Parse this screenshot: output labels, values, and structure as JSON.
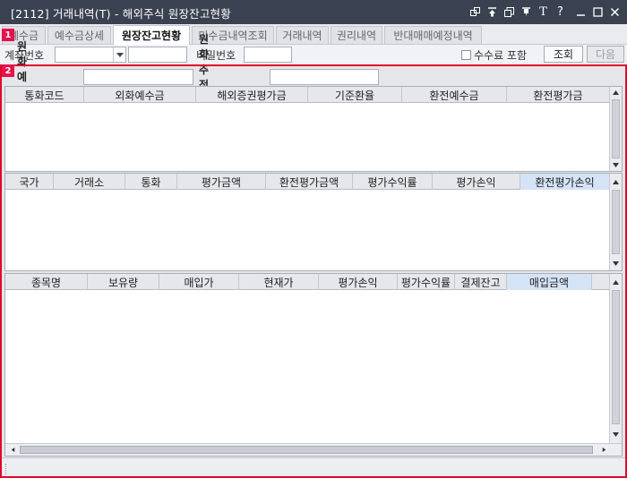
{
  "window": {
    "title": "[2112] 거래내역(T) - 해외주식 원장잔고현황",
    "controls": [
      "link-icon",
      "pin-top-icon",
      "restore-window-icon",
      "bookmark-icon",
      "font-icon",
      "help-icon",
      "minimize-icon",
      "maximize-icon",
      "close-icon"
    ],
    "font_glyph": "T",
    "help_glyph": "?"
  },
  "tabs": [
    {
      "label": "예수금",
      "active": false
    },
    {
      "label": "예수금상세",
      "active": false
    },
    {
      "label": "원장잔고현황",
      "active": true
    },
    {
      "label": "미수금내역조회",
      "active": false
    },
    {
      "label": "거래내역",
      "active": false
    },
    {
      "label": "권리내역",
      "active": false
    },
    {
      "label": "반대매매예정내역",
      "active": false
    }
  ],
  "badges": [
    "1",
    "2"
  ],
  "condition": {
    "account_label": "계좌번호",
    "account_value": "",
    "account_name": "",
    "password_label": "비밀번호",
    "password_value": "",
    "fee_label": "수수료 포함",
    "fee_checked": false,
    "query_button": "조회",
    "next_button": "다음"
  },
  "summary": {
    "krw_deposit_label": "원화예수금",
    "krw_deposit_value": "",
    "krw_asset_label": "원화추정자산",
    "krw_asset_value": ""
  },
  "grid1": {
    "columns": [
      "통화코드",
      "외화예수금",
      "해외증권평가금",
      "기준환율",
      "환전예수금",
      "환전평가금"
    ],
    "rows": []
  },
  "grid2": {
    "columns": [
      "국가",
      "거래소",
      "통화",
      "평가금액",
      "환전평가금액",
      "평가수익률",
      "평가손익",
      "환전평가손익"
    ],
    "highlight_column": 7,
    "rows": []
  },
  "grid3": {
    "columns": [
      "종목명",
      "보유량",
      "매입가",
      "현재가",
      "평가손익",
      "평가수익률",
      "결제잔고",
      "매입금액"
    ],
    "highlight_column": 7,
    "rows": []
  },
  "colors": {
    "titlebar": "#3a4150",
    "badge": "#e8114a",
    "focus_outline": "#e00a2a",
    "header_highlight": "#d4e3f5"
  }
}
